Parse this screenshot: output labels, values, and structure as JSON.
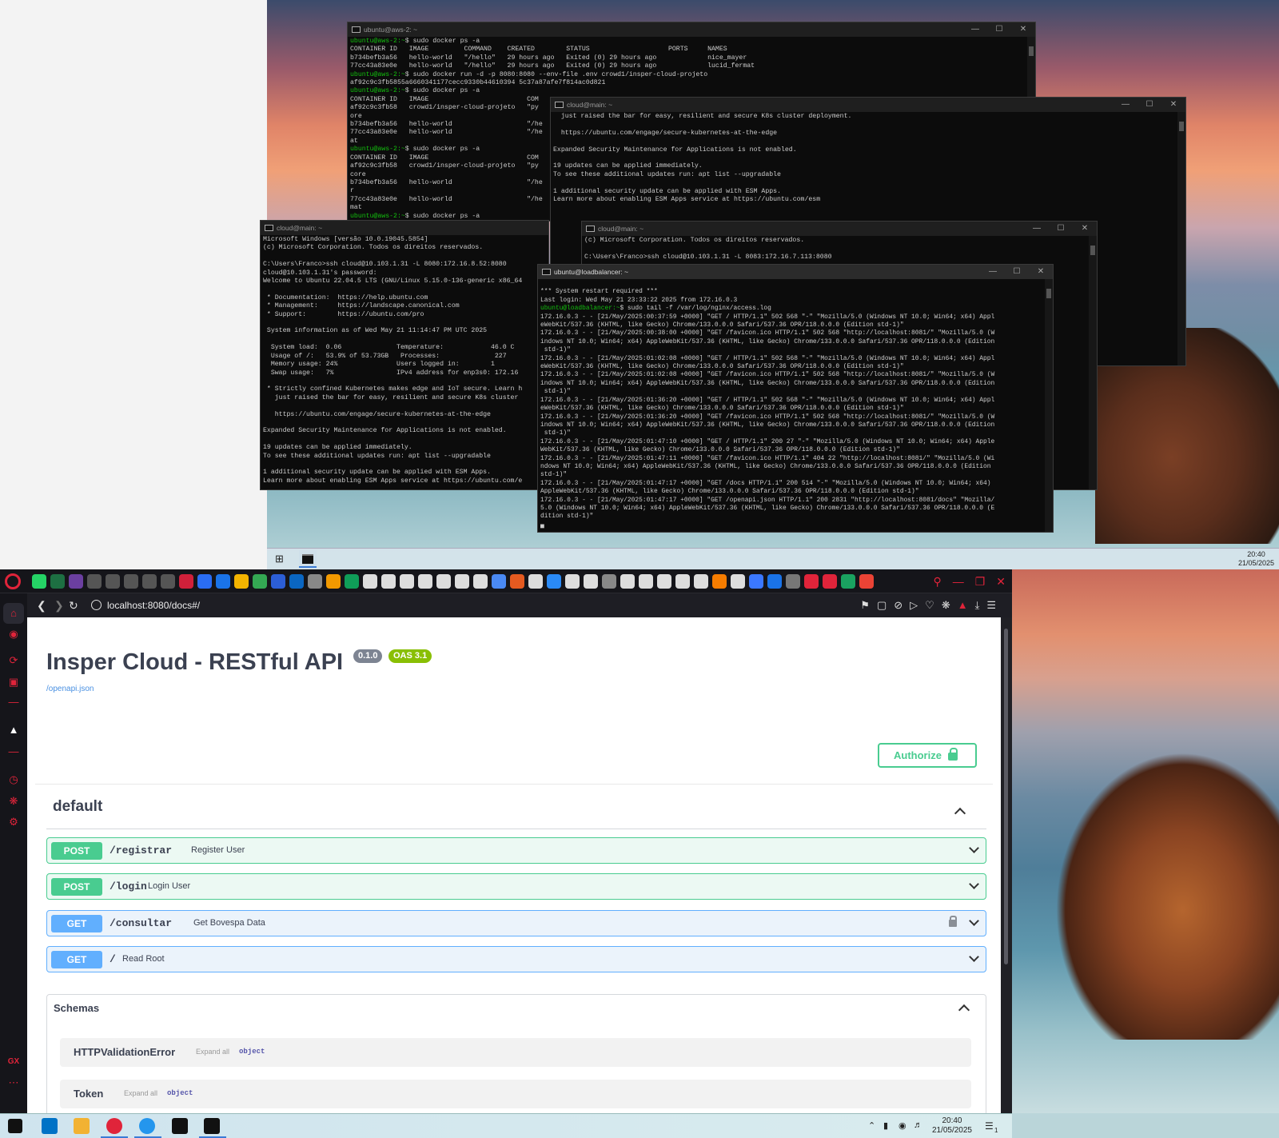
{
  "top_desktop": {
    "taskbar_time": "20:40",
    "taskbar_date": "21/05/2025"
  },
  "terminals": {
    "aws": {
      "title": "ubuntu@aws-2: ~",
      "lines": [
        [
          "g",
          "ubuntu@aws-2:~",
          "$ sudo docker ps -a"
        ],
        [
          "",
          "",
          "CONTAINER ID   IMAGE         COMMAND    CREATED        STATUS                    PORTS     NAMES"
        ],
        [
          "",
          "",
          "b734befb3a56   hello-world   \"/hello\"   29 hours ago   Exited (0) 29 hours ago             nice_mayer"
        ],
        [
          "",
          "",
          "77cc43a83e0e   hello-world   \"/hello\"   29 hours ago   Exited (0) 29 hours ago             lucid_fermat"
        ],
        [
          "g",
          "ubuntu@aws-2:~",
          "$ sudo docker run -d -p 8080:8080 --env-file .env crowd1/insper-cloud-projeto"
        ],
        [
          "",
          "",
          "af92c9c3fb5855a6660341177cecc9330b44610394 5c37a87afe7f814ac0d821"
        ],
        [
          "g",
          "ubuntu@aws-2:~",
          "$ sudo docker ps -a"
        ],
        [
          "",
          "",
          "CONTAINER ID   IMAGE                         COM"
        ],
        [
          "",
          "",
          "af92c9c3fb58   crowd1/insper-cloud-projeto   \"py"
        ],
        [
          "",
          "",
          "ore"
        ],
        [
          "",
          "",
          "b734befb3a56   hello-world                   \"/he"
        ],
        [
          "",
          "",
          "77cc43a83e0e   hello-world                   \"/he"
        ],
        [
          "",
          "",
          "at"
        ],
        [
          "g",
          "ubuntu@aws-2:~",
          "$ sudo docker ps -a"
        ],
        [
          "",
          "",
          "CONTAINER ID   IMAGE                         COM"
        ],
        [
          "",
          "",
          "af92c9c3fb58   crowd1/insper-cloud-projeto   \"py"
        ],
        [
          "",
          "",
          "core"
        ],
        [
          "",
          "",
          "b734befb3a56   hello-world                   \"/he"
        ],
        [
          "",
          "",
          "r"
        ],
        [
          "",
          "",
          "77cc43a83e0e   hello-world                   \"/he"
        ],
        [
          "",
          "",
          "mat"
        ],
        [
          "g",
          "ubuntu@aws-2:~",
          "$ sudo docker ps -a"
        ]
      ]
    },
    "cloud_main_a": {
      "title": "cloud@main: ~",
      "lines": [
        [
          "",
          "",
          "  just raised the bar for easy, resilient and secure K8s cluster deployment."
        ],
        [
          "",
          "",
          ""
        ],
        [
          "",
          "",
          "  https://ubuntu.com/engage/secure-kubernetes-at-the-edge"
        ],
        [
          "",
          "",
          ""
        ],
        [
          "",
          "",
          "Expanded Security Maintenance for Applications is not enabled."
        ],
        [
          "",
          "",
          ""
        ],
        [
          "",
          "",
          "19 updates can be applied immediately."
        ],
        [
          "",
          "",
          "To see these additional updates run: apt list --upgradable"
        ],
        [
          "",
          "",
          ""
        ],
        [
          "",
          "",
          "1 additional security update can be applied with ESM Apps."
        ],
        [
          "",
          "",
          "Learn more about enabling ESM Apps service at https://ubuntu.com/esm"
        ]
      ]
    },
    "cloud_main_b": {
      "title": "cloud@main: ~",
      "lines": [
        [
          "",
          "",
          "Microsoft Windows [versão 10.0.19045.5854]"
        ],
        [
          "",
          "",
          "(c) Microsoft Corporation. Todos os direitos reservados."
        ],
        [
          "",
          "",
          ""
        ],
        [
          "",
          "",
          "C:\\Users\\Franco>ssh cloud@10.103.1.31 -L 8080:172.16.8.52:8080"
        ],
        [
          "",
          "",
          "cloud@10.103.1.31's password:"
        ],
        [
          "",
          "",
          "Welcome to Ubuntu 22.04.5 LTS (GNU/Linux 5.15.0-136-generic x86_64"
        ],
        [
          "",
          "",
          ""
        ],
        [
          "",
          "",
          " * Documentation:  https://help.ubuntu.com"
        ],
        [
          "",
          "",
          " * Management:     https://landscape.canonical.com"
        ],
        [
          "",
          "",
          " * Support:        https://ubuntu.com/pro"
        ],
        [
          "",
          "",
          ""
        ],
        [
          "",
          "",
          " System information as of Wed May 21 11:14:47 PM UTC 2025"
        ],
        [
          "",
          "",
          ""
        ],
        [
          "",
          "",
          "  System load:  0.06              Temperature:            46.0 C"
        ],
        [
          "",
          "",
          "  Usage of /:   53.9% of 53.73GB   Processes:              227"
        ],
        [
          "",
          "",
          "  Memory usage: 24%               Users logged in:        1"
        ],
        [
          "",
          "",
          "  Swap usage:   7%                IPv4 address for enp3s0: 172.16"
        ],
        [
          "",
          "",
          ""
        ],
        [
          "",
          "",
          " * Strictly confined Kubernetes makes edge and IoT secure. Learn h"
        ],
        [
          "",
          "",
          "   just raised the bar for easy, resilient and secure K8s cluster"
        ],
        [
          "",
          "",
          ""
        ],
        [
          "",
          "",
          "   https://ubuntu.com/engage/secure-kubernetes-at-the-edge"
        ],
        [
          "",
          "",
          ""
        ],
        [
          "",
          "",
          "Expanded Security Maintenance for Applications is not enabled."
        ],
        [
          "",
          "",
          ""
        ],
        [
          "",
          "",
          "19 updates can be applied immediately."
        ],
        [
          "",
          "",
          "To see these additional updates run: apt list --upgradable"
        ],
        [
          "",
          "",
          ""
        ],
        [
          "",
          "",
          "1 additional security update can be applied with ESM Apps."
        ],
        [
          "",
          "",
          "Learn more about enabling ESM Apps service at https://ubuntu.com/e"
        ]
      ]
    },
    "cloud_main_c": {
      "title": "cloud@main: ~",
      "lines": [
        [
          "",
          "",
          "(c) Microsoft Corporation. Todos os direitos reservados."
        ],
        [
          "",
          "",
          ""
        ],
        [
          "",
          "",
          "C:\\Users\\Franco>ssh cloud@10.103.1.31 -L 8083:172.16.7.113:8080"
        ]
      ]
    },
    "loadbalancer": {
      "title": "ubuntu@loadbalancer: ~",
      "lines": [
        [
          "",
          "",
          ""
        ],
        [
          "",
          "",
          "*** System restart required ***"
        ],
        [
          "",
          "",
          "Last login: Wed May 21 23:33:22 2025 from 172.16.0.3"
        ],
        [
          "g",
          "ubuntu@loadbalancer:~",
          "$ sudo tail -f /var/log/nginx/access.log"
        ],
        [
          "",
          "",
          "172.16.0.3 - - [21/May/2025:00:37:59 +0000] \"GET / HTTP/1.1\" 502 568 \"-\" \"Mozilla/5.0 (Windows NT 10.0; Win64; x64) Appl"
        ],
        [
          "",
          "",
          "eWebKit/537.36 (KHTML, like Gecko) Chrome/133.0.0.0 Safari/537.36 OPR/118.0.0.0 (Edition std-1)\""
        ],
        [
          "",
          "",
          "172.16.0.3 - - [21/May/2025:00:38:00 +0000] \"GET /favicon.ico HTTP/1.1\" 502 568 \"http://localhost:8081/\" \"Mozilla/5.0 (W"
        ],
        [
          "",
          "",
          "indows NT 10.0; Win64; x64) AppleWebKit/537.36 (KHTML, like Gecko) Chrome/133.0.0.0 Safari/537.36 OPR/118.0.0.0 (Edition"
        ],
        [
          "",
          "",
          " std-1)\""
        ],
        [
          "",
          "",
          "172.16.0.3 - - [21/May/2025:01:02:08 +0000] \"GET / HTTP/1.1\" 502 568 \"-\" \"Mozilla/5.0 (Windows NT 10.0; Win64; x64) Appl"
        ],
        [
          "",
          "",
          "eWebKit/537.36 (KHTML, like Gecko) Chrome/133.0.0.0 Safari/537.36 OPR/118.0.0.0 (Edition std-1)\""
        ],
        [
          "",
          "",
          "172.16.0.3 - - [21/May/2025:01:02:08 +0000] \"GET /favicon.ico HTTP/1.1\" 502 568 \"http://localhost:8081/\" \"Mozilla/5.0 (W"
        ],
        [
          "",
          "",
          "indows NT 10.0; Win64; x64) AppleWebKit/537.36 (KHTML, like Gecko) Chrome/133.0.0.0 Safari/537.36 OPR/118.0.0.0 (Edition"
        ],
        [
          "",
          "",
          " std-1)\""
        ],
        [
          "",
          "",
          "172.16.0.3 - - [21/May/2025:01:36:20 +0000] \"GET / HTTP/1.1\" 502 568 \"-\" \"Mozilla/5.0 (Windows NT 10.0; Win64; x64) Appl"
        ],
        [
          "",
          "",
          "eWebKit/537.36 (KHTML, like Gecko) Chrome/133.0.0.0 Safari/537.36 OPR/118.0.0.0 (Edition std-1)\""
        ],
        [
          "",
          "",
          "172.16.0.3 - - [21/May/2025:01:36:20 +0000] \"GET /favicon.ico HTTP/1.1\" 502 568 \"http://localhost:8081/\" \"Mozilla/5.0 (W"
        ],
        [
          "",
          "",
          "indows NT 10.0; Win64; x64) AppleWebKit/537.36 (KHTML, like Gecko) Chrome/133.0.0.0 Safari/537.36 OPR/118.0.0.0 (Edition"
        ],
        [
          "",
          "",
          " std-1)\""
        ],
        [
          "",
          "",
          "172.16.0.3 - - [21/May/2025:01:47:10 +0000] \"GET / HTTP/1.1\" 200 27 \"-\" \"Mozilla/5.0 (Windows NT 10.0; Win64; x64) Apple"
        ],
        [
          "",
          "",
          "WebKit/537.36 (KHTML, like Gecko) Chrome/133.0.0.0 Safari/537.36 OPR/118.0.0.0 (Edition std-1)\""
        ],
        [
          "",
          "",
          "172.16.0.3 - - [21/May/2025:01:47:11 +0000] \"GET /favicon.ico HTTP/1.1\" 404 22 \"http://localhost:8081/\" \"Mozilla/5.0 (Wi"
        ],
        [
          "",
          "",
          "ndows NT 10.0; Win64; x64) AppleWebKit/537.36 (KHTML, like Gecko) Chrome/133.0.0.0 Safari/537.36 OPR/118.0.0.0 (Edition"
        ],
        [
          "",
          "",
          "std-1)\""
        ],
        [
          "",
          "",
          "172.16.0.3 - - [21/May/2025:01:47:17 +0000] \"GET /docs HTTP/1.1\" 200 514 \"-\" \"Mozilla/5.0 (Windows NT 10.0; Win64; x64)"
        ],
        [
          "",
          "",
          "AppleWebKit/537.36 (KHTML, like Gecko) Chrome/133.0.0.0 Safari/537.36 OPR/118.0.0.0 (Edition std-1)\""
        ],
        [
          "",
          "",
          "172.16.0.3 - - [21/May/2025:01:47:17 +0000] \"GET /openapi.json HTTP/1.1\" 200 2831 \"http://localhost:8081/docs\" \"Mozilla/"
        ],
        [
          "",
          "",
          "5.0 (Windows NT 10.0; Win64; x64) AppleWebKit/537.36 (KHTML, like Gecko) Chrome/133.0.0.0 Safari/537.36 OPR/118.0.0.0 (E"
        ],
        [
          "",
          "",
          "dition std-1)\""
        ],
        [
          "",
          "",
          "▄"
        ]
      ]
    }
  },
  "browser": {
    "url": "localhost:8080/docs#/",
    "tab_icon_colors": [
      "#25d366",
      "#1d6f42",
      "#6b3fa0",
      "#555",
      "#555",
      "#555",
      "#555",
      "#555",
      "#d0203a",
      "#2a6df4",
      "#1a73e8",
      "#f4b400",
      "#34a853",
      "#2c5ed6",
      "#0a66c2",
      "#888",
      "#f29900",
      "#0f9d58",
      "#ddd",
      "#ddd",
      "#ddd",
      "#ddd",
      "#ddd",
      "#ddd",
      "#ddd",
      "#4a89f3",
      "#e55a20",
      "#ddd",
      "#2a8af6",
      "#ddd",
      "#ddd",
      "#888",
      "#ddd",
      "#ddd",
      "#ddd",
      "#ddd",
      "#ddd",
      "#f57c00",
      "#ddd",
      "#3b78ff",
      "#1a73e8",
      "#777",
      "#e0243a",
      "#e0243a",
      "#1aa260",
      "#ea4335"
    ]
  },
  "swagger": {
    "title": "Insper Cloud - RESTful API",
    "version_badge": "0.1.0",
    "oas_badge": "OAS 3.1",
    "openapi_link": "/openapi.json",
    "authorize_label": "Authorize",
    "tag_name": "default",
    "operations": [
      {
        "method": "POST",
        "path": "/registrar",
        "summary": "Register User"
      },
      {
        "method": "POST",
        "path": "/login",
        "summary": "Login User"
      },
      {
        "method": "GET",
        "path": "/consultar",
        "summary": "Get Bovespa Data"
      },
      {
        "method": "GET",
        "path": "/",
        "summary": "Read Root"
      }
    ],
    "schemas_title": "Schemas",
    "schemas": [
      {
        "name": "HTTPValidationError",
        "expand": "Expand all",
        "type": "object"
      },
      {
        "name": "Token",
        "expand": "Expand all",
        "type": "object"
      }
    ]
  },
  "taskbar": {
    "time": "20:40",
    "date": "21/05/2025",
    "notifications": "1",
    "icon_colors": [
      "#0072c6",
      "#f2b233",
      "#e0243a",
      "#2496ed",
      "#111",
      "#111"
    ]
  },
  "sidebar": {
    "bottom_label": "GX"
  }
}
